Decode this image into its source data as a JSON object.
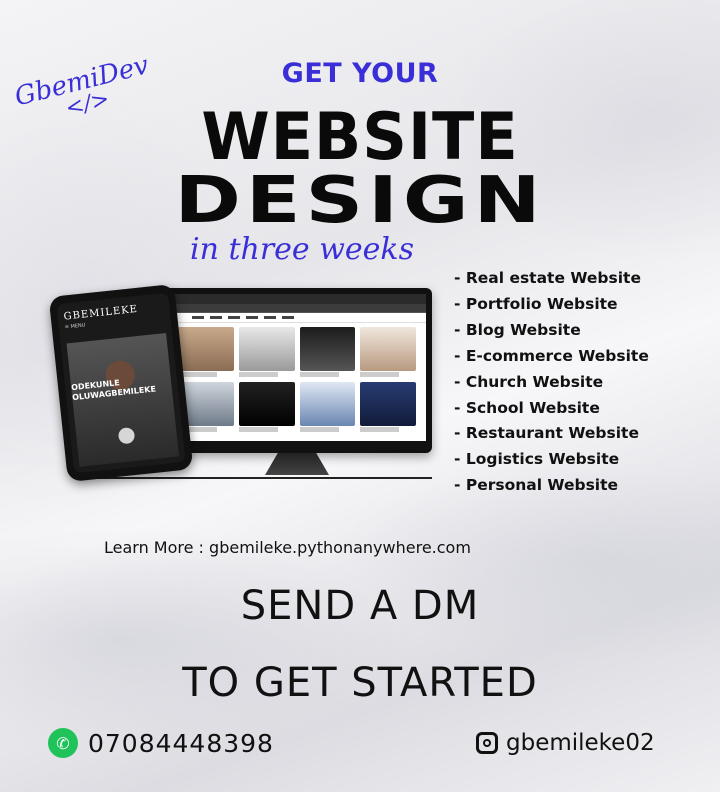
{
  "brand": {
    "name": "GbemiDev",
    "code_symbol": "</>"
  },
  "headline": {
    "get_your": "GET YOUR",
    "website": "WEBSITE",
    "design": "DESIGN",
    "tagline": "in three weeks"
  },
  "mockup": {
    "phone_title": "GBEMILEKE",
    "phone_menu": "≡ MENU",
    "phone_caption": "ODEKUNLE OLUWAGBEMILEKE"
  },
  "services": [
    "- Real estate Website",
    "- Portfolio Website",
    "- Blog Website",
    "- E-commerce Website",
    "- Church Website",
    "- School Website",
    "- Restaurant Website",
    "- Logistics Website",
    "- Personal Website"
  ],
  "learn_more": "Learn More : gbemileke.pythonanywhere.com",
  "cta": {
    "line1": "SEND A DM",
    "line2": "TO GET STARTED"
  },
  "contact": {
    "whatsapp_icon": "whatsapp-icon",
    "phone": "07084448398",
    "instagram_icon": "instagram-icon",
    "instagram": "gbemileke02"
  },
  "colors": {
    "accent": "#3a2fd6",
    "text": "#111111",
    "whatsapp": "#1fc35a"
  }
}
